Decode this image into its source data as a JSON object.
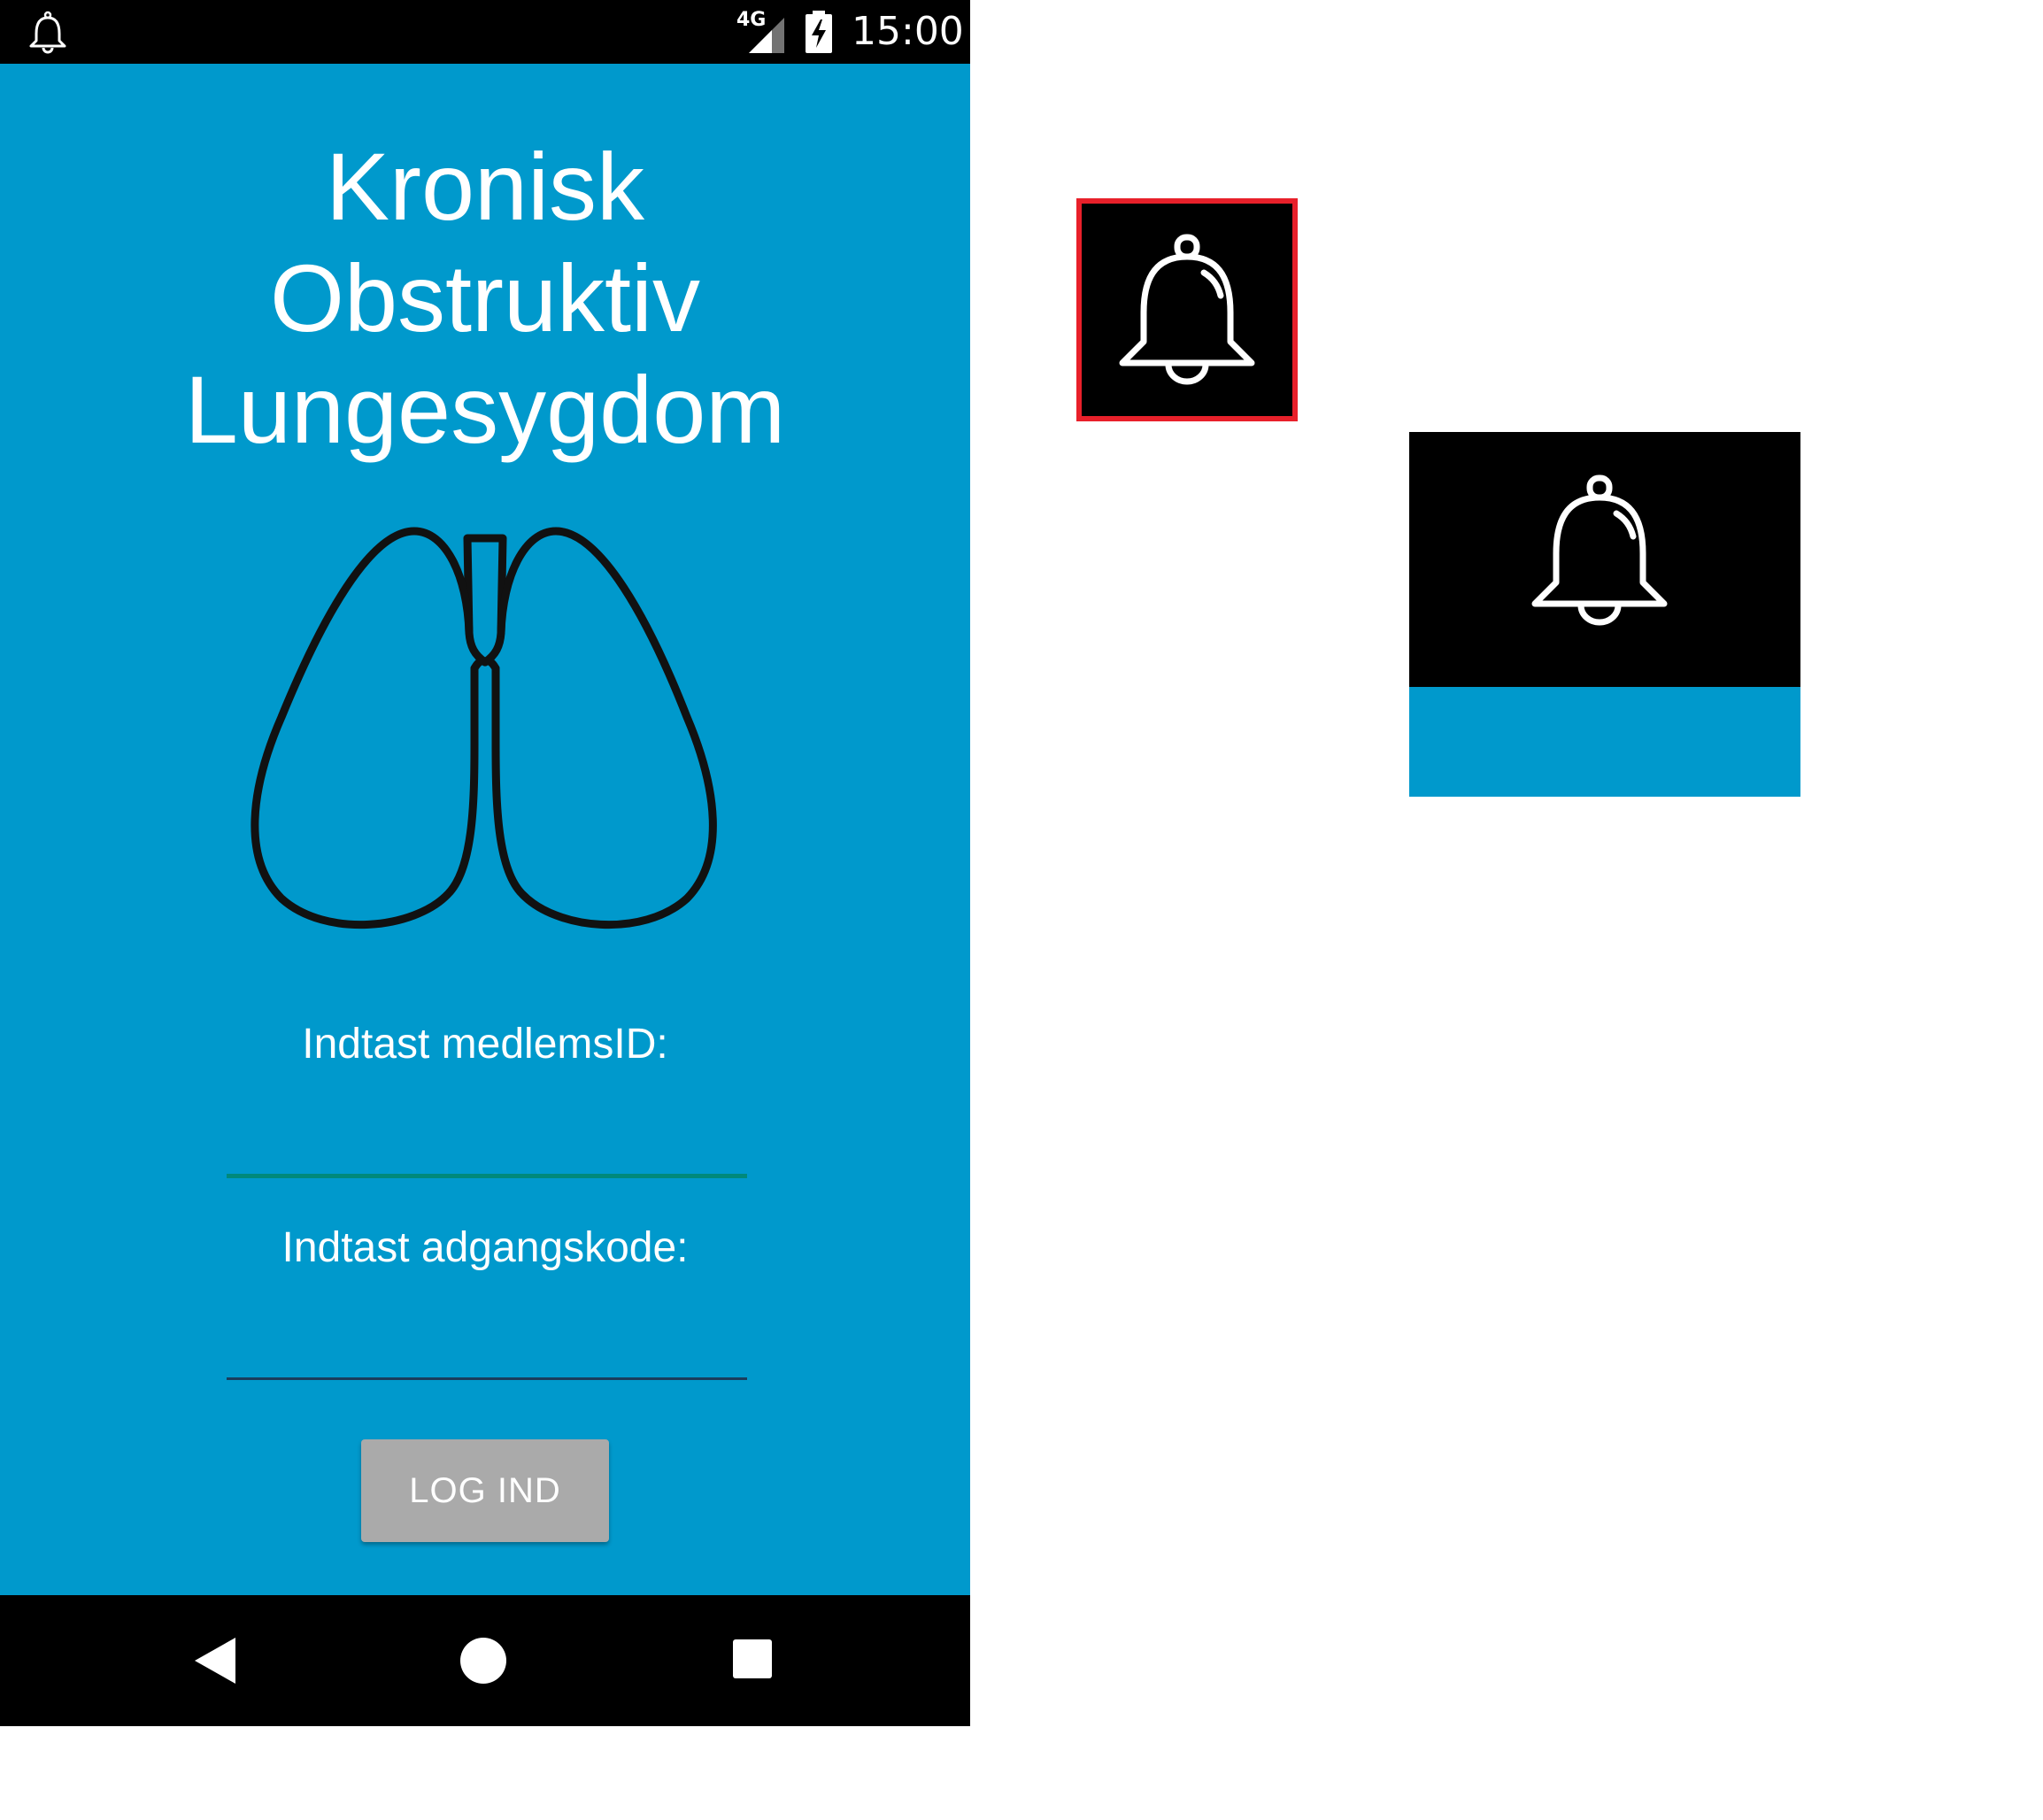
{
  "status_bar": {
    "notification_icon": "bell-icon",
    "network": "4G",
    "signal_icon": "signal-icon",
    "battery_icon": "battery-charging-icon",
    "time": "15:00"
  },
  "app": {
    "title_lines": [
      "Kronisk",
      "Obstruktiv",
      "Lungesygdom"
    ],
    "logo_icon": "lungs-icon",
    "member_id_label": "Indtast medlemsID:",
    "member_id_value": "",
    "password_label": "Indtast adgangskode:",
    "password_value": "",
    "login_button": "LOG IND"
  },
  "nav_bar": {
    "back_icon": "back-icon",
    "home_icon": "home-icon",
    "recents_icon": "recents-icon"
  },
  "crops": {
    "highlight_icon": "bell-icon",
    "plain_icon": "bell-icon"
  },
  "colors": {
    "background": "#0099cc",
    "bars": "#000000",
    "button": "#aaaaaa",
    "highlight_border": "#e8202a",
    "input_focus_line": "#00897b"
  }
}
